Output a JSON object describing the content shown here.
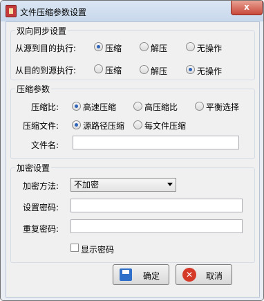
{
  "window": {
    "title": "文件压缩参数设置",
    "close_glyph": "x"
  },
  "sync": {
    "legend": "双向同步设置",
    "row1_label": "从源到目的执行:",
    "row2_label": "从目的到源执行:",
    "opt_compress": "压缩",
    "opt_decompress": "解压",
    "opt_none": "无操作"
  },
  "compress": {
    "legend": "压缩参数",
    "ratio_label": "压缩比:",
    "ratio_high_speed": "高速压缩",
    "ratio_high_compression": "高压缩比",
    "ratio_balanced": "平衡选择",
    "file_label": "压缩文件:",
    "file_source_path": "源路径压缩",
    "file_per_file": "每文件压缩",
    "filename_label": "文件名:",
    "filename_value": ""
  },
  "encrypt": {
    "legend": "加密设置",
    "method_label": "加密方法:",
    "method_value": "不加密",
    "password_label": "设置密码:",
    "password_value": "",
    "repeat_label": "重复密码:",
    "repeat_value": "",
    "show_password_label": "显示密码"
  },
  "buttons": {
    "ok": "确定",
    "cancel": "取消",
    "cancel_glyph": "✕"
  }
}
